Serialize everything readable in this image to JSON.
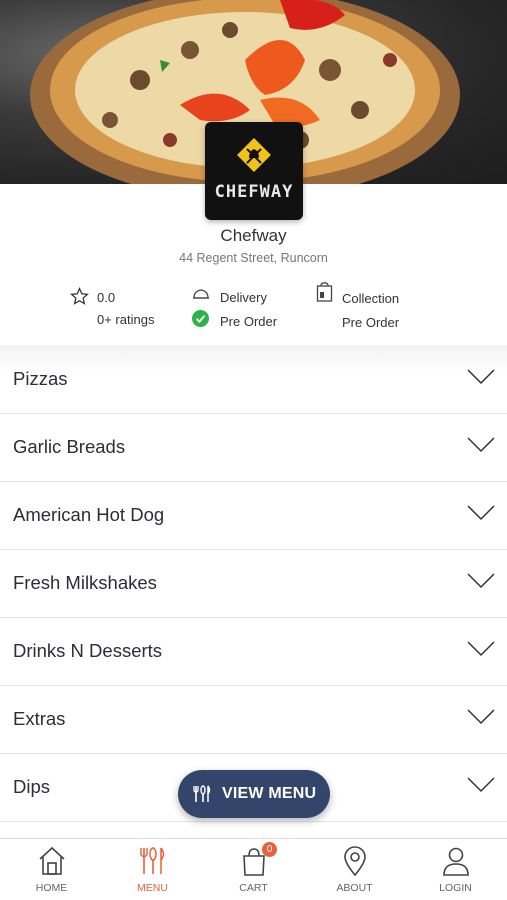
{
  "restaurant": {
    "logo_text": "CHEFWAY",
    "name": "Chefway",
    "address": "44 Regent Street, Runcorn"
  },
  "rating": {
    "value": "0.0",
    "count": "0+ ratings"
  },
  "delivery": {
    "label": "Delivery",
    "status": "Pre Order"
  },
  "collection": {
    "label": "Collection",
    "status": "Pre Order"
  },
  "categories": [
    "Pizzas",
    "Garlic Breads",
    "American Hot Dog",
    "Fresh Milkshakes",
    "Drinks N Desserts",
    "Extras",
    "Dips"
  ],
  "view_menu_label": "VIEW MENU",
  "tabs": [
    {
      "label": "HOME",
      "icon": "home-icon"
    },
    {
      "label": "MENU",
      "icon": "cutlery-icon",
      "active": true
    },
    {
      "label": "CART",
      "icon": "bag-icon",
      "badge": "0"
    },
    {
      "label": "ABOUT",
      "icon": "location-pin-icon"
    },
    {
      "label": "LOGIN",
      "icon": "user-icon"
    }
  ],
  "colors": {
    "accent": "#e8613a",
    "button": "#33456a",
    "check": "#2bb34a",
    "logo_gold": "#f2c21b"
  }
}
